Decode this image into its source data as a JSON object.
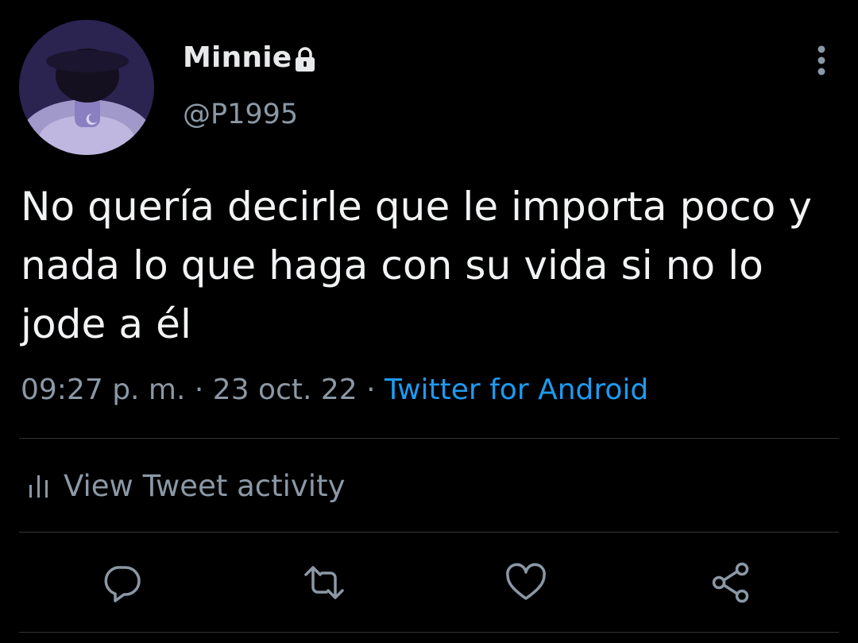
{
  "tweet": {
    "display_name": "Minnie",
    "handle": "@P1995",
    "text": "No quería decirle que le importa poco y nada lo que haga con su vida si no lo jode a él",
    "time": "09:27 p. m.",
    "date": "23 oct. 22",
    "source": "Twitter for Android",
    "separator": " · "
  },
  "activity": {
    "label": "View Tweet activity"
  },
  "icons": {
    "lock": "lock-icon",
    "more": "more-vertical-icon",
    "activity": "bar-chart-icon",
    "reply": "reply-icon",
    "retweet": "retweet-icon",
    "like": "heart-icon",
    "share": "share-icon"
  },
  "colors": {
    "background": "#000000",
    "text_primary": "#e7e9ea",
    "text_secondary": "#8b98a5",
    "link": "#1d9bf0",
    "divider": "#2f3336"
  }
}
